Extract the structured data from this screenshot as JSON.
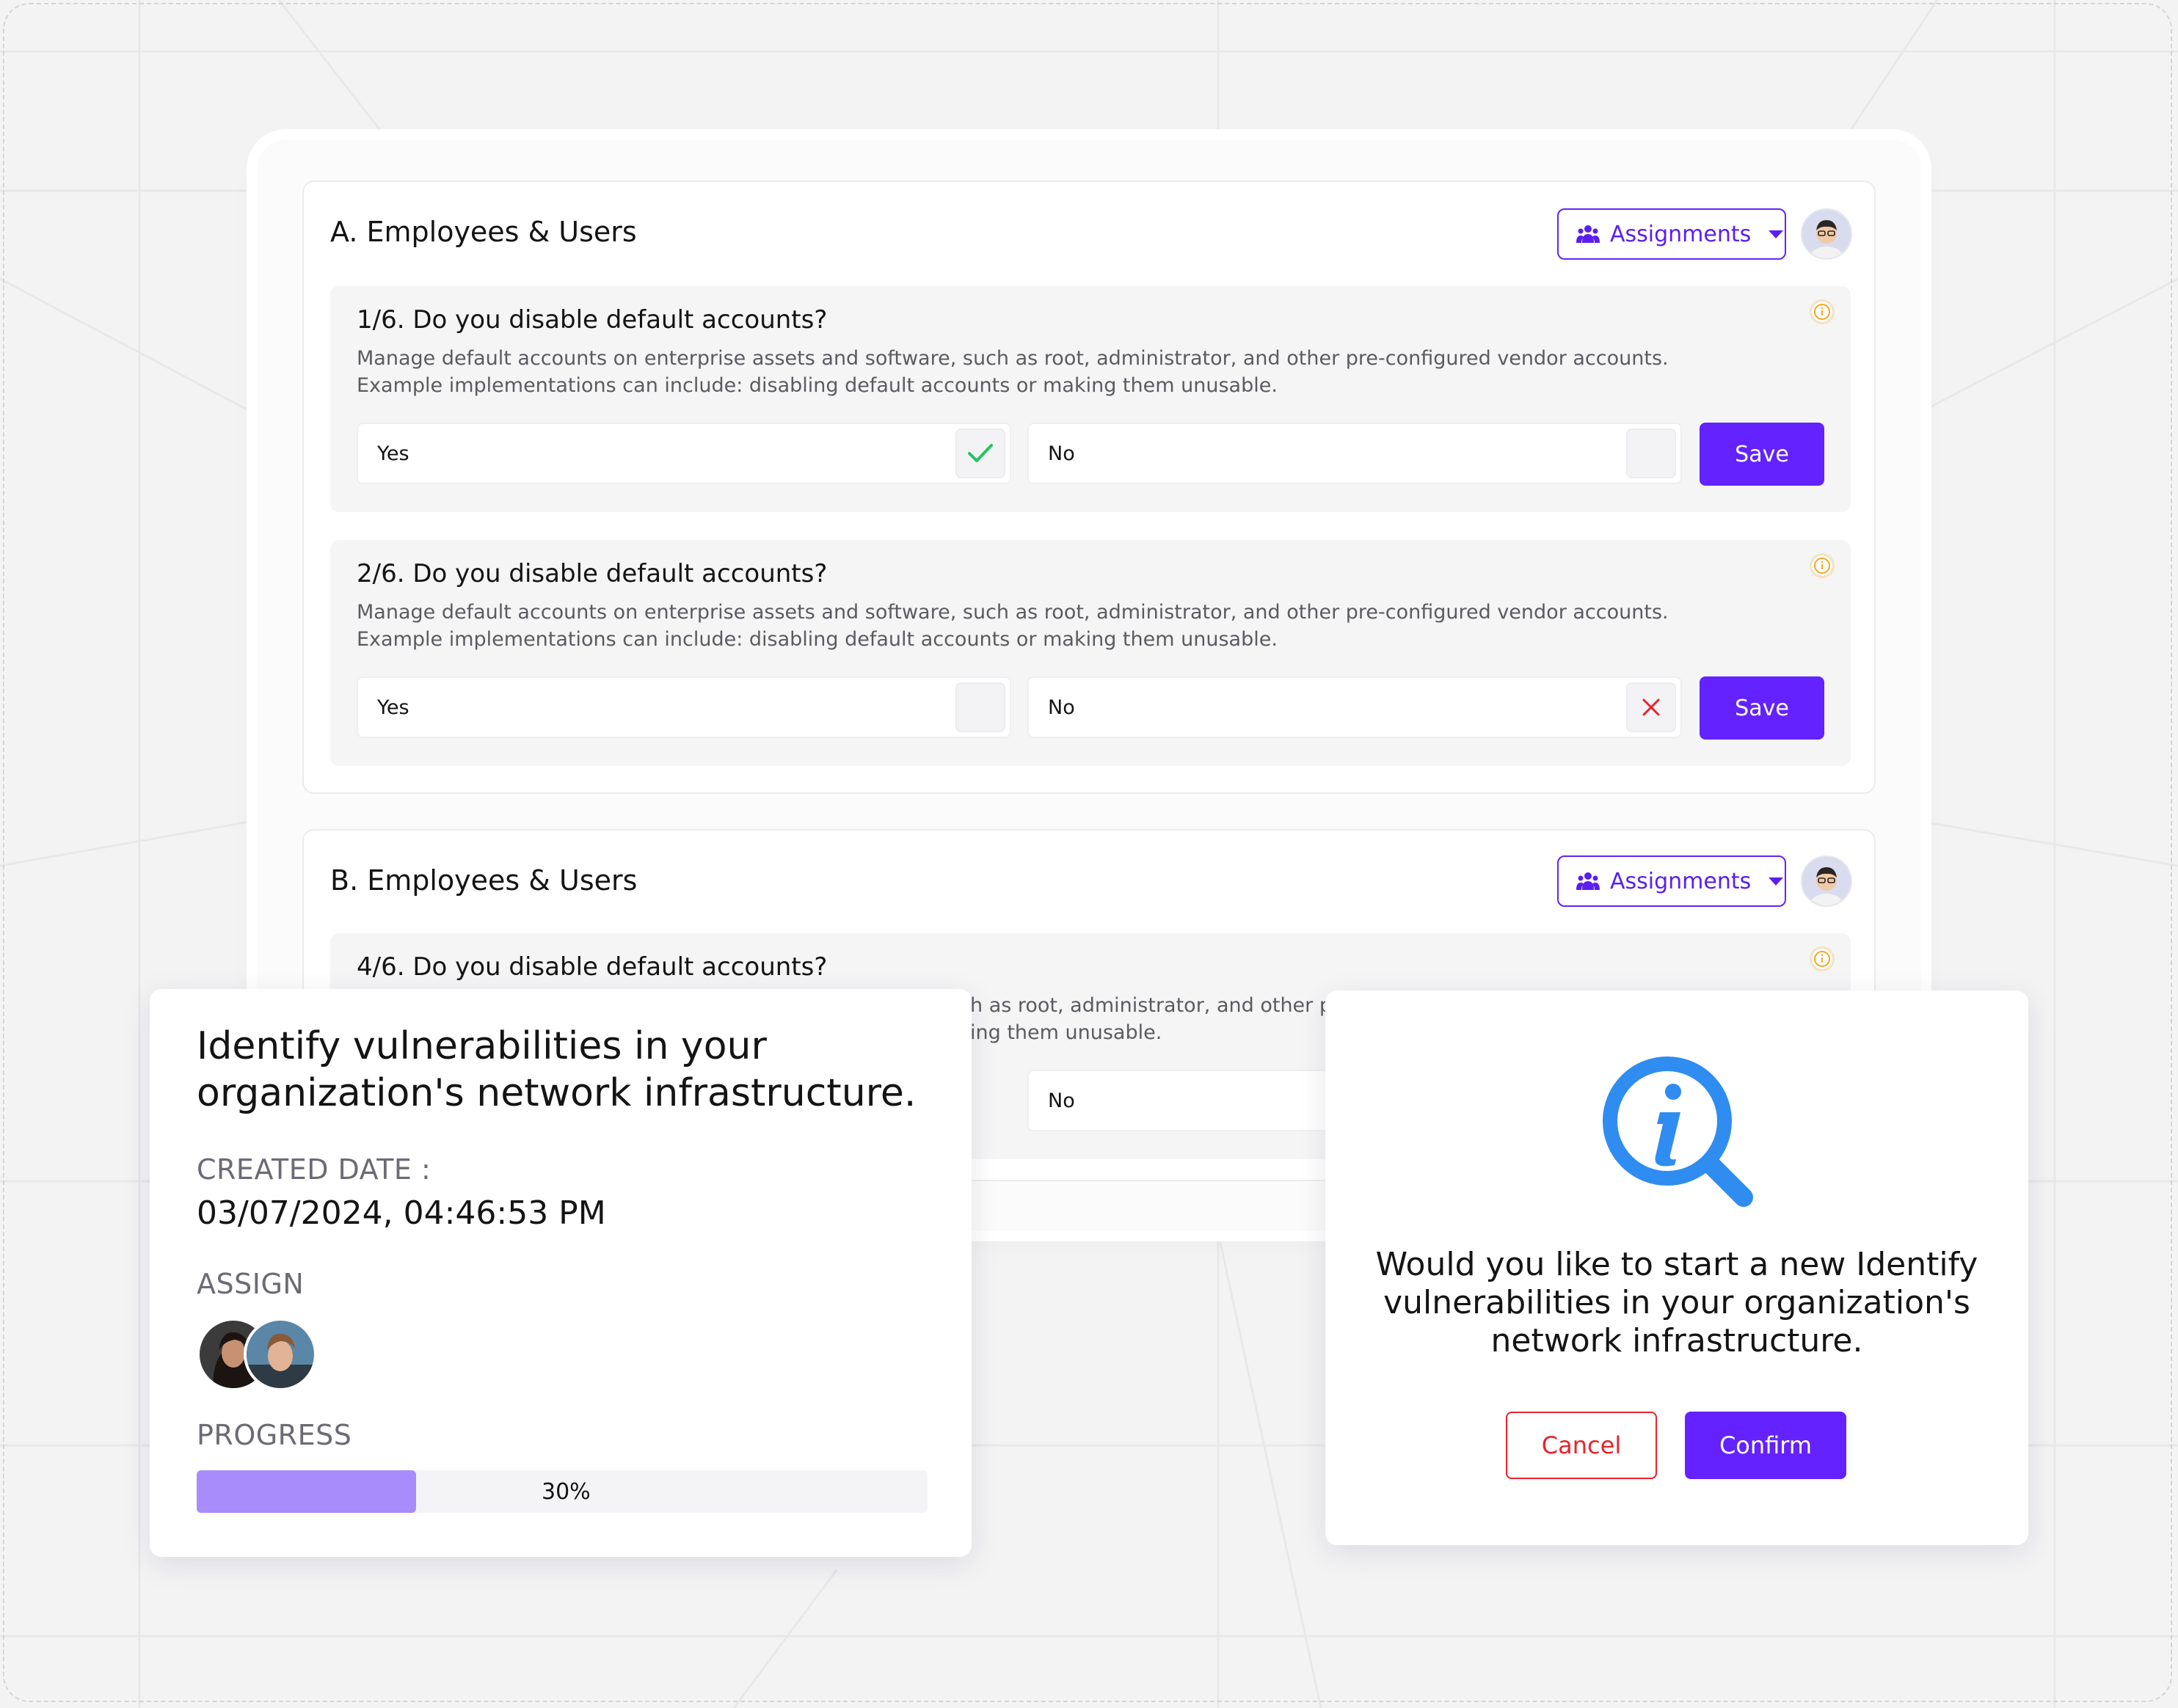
{
  "colors": {
    "accent": "#6322ff",
    "success": "#22c55e",
    "danger": "#e8232d",
    "progress_fill": "#a98cfb",
    "info_blue": "#2f8cf0",
    "warning": "#f5a623"
  },
  "section_a": {
    "title": "A. Employees & Users",
    "assignments_label": "Assignments",
    "questions": [
      {
        "title": "1/6. Do you disable default accounts?",
        "description": "Manage default accounts on enterprise assets and software, such as root, administrator, and other pre-configured vendor accounts. Example implementations can include: disabling default accounts or making them unusable.",
        "yes_label": "Yes",
        "no_label": "No",
        "selected": "yes",
        "save_label": "Save"
      },
      {
        "title": "2/6. Do you disable default accounts?",
        "description": "Manage default accounts on enterprise assets and software, such as root, administrator, and other pre-configured vendor accounts. Example implementations can include: disabling default accounts or making them unusable.",
        "yes_label": "Yes",
        "no_label": "No",
        "selected": "no",
        "save_label": "Save"
      }
    ]
  },
  "section_b": {
    "title": "B. Employees & Users",
    "assignments_label": "Assignments",
    "questions": [
      {
        "title": "4/6. Do you disable default accounts?",
        "description_visible_line1": "h as root, administrator, and other pre",
        "description_visible_line2": "ing them unusable.",
        "no_label": "No"
      }
    ]
  },
  "task_card": {
    "title": "Identify vulnerabilities in your organization's network infrastructure.",
    "created_label": "CREATED DATE :",
    "created_value": "03/07/2024, 04:46:53 PM",
    "assign_label": "ASSIGN",
    "progress_label": "PROGRESS",
    "progress_value": 30,
    "progress_text": "30%"
  },
  "confirm_dialog": {
    "icon": "info-search-icon",
    "message": "Would you like to start a new Identify vulnerabilities in your organization's network infrastructure.",
    "cancel_label": "Cancel",
    "confirm_label": "Confirm"
  }
}
